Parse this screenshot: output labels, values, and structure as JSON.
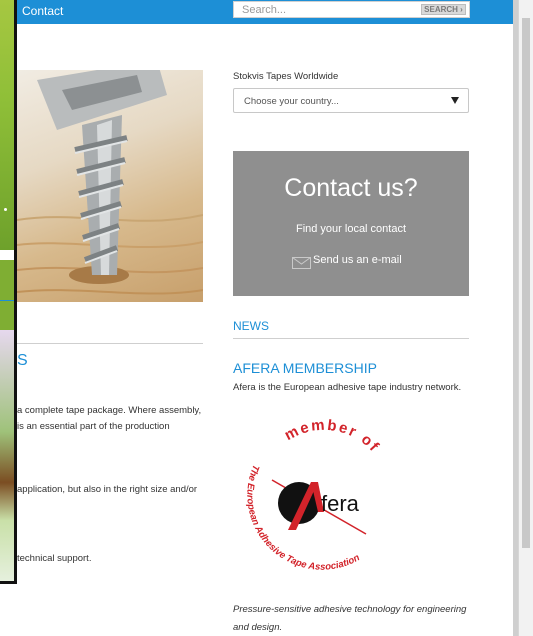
{
  "header": {
    "nav_contact": "Contact",
    "search_placeholder": "Search...",
    "search_button": "SEARCH ›"
  },
  "left": {
    "heading": "S",
    "text_lines": [
      "a complete tape package. Where assembly,",
      "is an essential part of the production",
      "application, but also in the right size and/or",
      "technical support."
    ]
  },
  "worldwide": {
    "label": "Stokvis Tapes Worldwide",
    "select_value": "Choose your country..."
  },
  "contact": {
    "title": "Contact us?",
    "find_local": "Find your local contact",
    "send_email": "Send us an e-mail"
  },
  "news": {
    "label": "NEWS",
    "item_title": "AFERA MEMBERSHIP",
    "item_desc": "Afera is the European adhesive tape industry network.",
    "footer_lines": [
      "Pressure-sensitive adhesive technology for engineering",
      "and design."
    ]
  },
  "afera_logo": {
    "top_text": "member of",
    "ring_text": "The European Adhesive Tape Association",
    "brand": "fera"
  },
  "colors": {
    "accent": "#1d8fd6",
    "contact_box": "#8f8f8f",
    "logo_red": "#d2232a"
  },
  "icons": [
    "mail-icon",
    "chevron-down-icon"
  ]
}
